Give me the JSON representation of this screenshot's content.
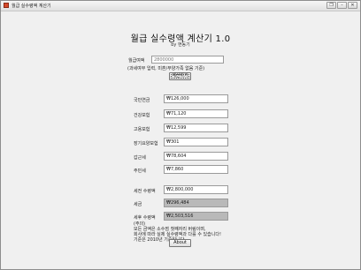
{
  "window": {
    "title": "월급 실수령액 계산기",
    "controls": [
      "restore-down",
      "minimize",
      "close"
    ]
  },
  "header": {
    "title": "월급 실수령액 계산기 1.0",
    "subtitle": "by 현동기"
  },
  "salary_input": {
    "label": "월급여액",
    "value": "2800000",
    "note": "(과세여부 입력, 미혼/부양가족 없음 기준)"
  },
  "calc_button": "계산하기",
  "deductions": [
    {
      "label": "국민연금",
      "value": "₩126,000"
    },
    {
      "label": "건강보험",
      "value": "₩71,120"
    },
    {
      "label": "고용보험",
      "value": "₩12,599"
    },
    {
      "label": "장기요양보험",
      "value": "₩301"
    },
    {
      "label": "갑근세",
      "value": "₩78,604"
    },
    {
      "label": "주민세",
      "value": "₩7,860"
    }
  ],
  "summary": [
    {
      "label": "세전 수령액",
      "value": "₩2,800,000",
      "shaded": false
    },
    {
      "label": "세금",
      "value": "₩296,484",
      "shaded": true
    },
    {
      "label": "세후 수령액",
      "value": "₩2,503,516",
      "shaded": true
    }
  ],
  "info": {
    "heading": "(주의)",
    "lines": [
      "모든 금액은 소수점 첫째자리 버림이며,",
      "회사에 따라 실제 실수령액과 다를 수 있습니다!",
      "기준은 2010년 기준입니다."
    ]
  },
  "about_button": "About"
}
